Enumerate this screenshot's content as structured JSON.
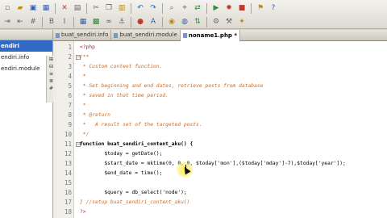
{
  "toolbar": {
    "row1": [
      {
        "name": "new-file-icon",
        "glyph": "▫",
        "color": "c-grey"
      },
      {
        "name": "open-folder-icon",
        "glyph": "▰",
        "color": "c-gold"
      },
      {
        "name": "save-icon",
        "glyph": "▣",
        "color": "c-blue"
      },
      {
        "name": "save-all-icon",
        "glyph": "▦",
        "color": "c-blue"
      },
      {
        "name": "sep"
      },
      {
        "name": "close-icon",
        "glyph": "✕",
        "color": "c-red"
      },
      {
        "name": "print-icon",
        "glyph": "▤",
        "color": "c-grey"
      },
      {
        "name": "sep"
      },
      {
        "name": "cut-icon",
        "glyph": "✂",
        "color": "c-grey"
      },
      {
        "name": "copy-icon",
        "glyph": "❐",
        "color": "c-grey"
      },
      {
        "name": "paste-icon",
        "glyph": "▥",
        "color": "c-gold"
      },
      {
        "name": "sep"
      },
      {
        "name": "undo-icon",
        "glyph": "↶",
        "color": "c-blue"
      },
      {
        "name": "redo-icon",
        "glyph": "↷",
        "color": "c-blue"
      },
      {
        "name": "sep"
      },
      {
        "name": "find-icon",
        "glyph": "⌕",
        "color": "c-grey"
      },
      {
        "name": "find-next-icon",
        "glyph": "⌖",
        "color": "c-grey"
      },
      {
        "name": "replace-icon",
        "glyph": "⇄",
        "color": "c-green"
      },
      {
        "name": "sep"
      },
      {
        "name": "run-icon",
        "glyph": "▶",
        "color": "c-green"
      },
      {
        "name": "debug-icon",
        "glyph": "✹",
        "color": "c-red"
      },
      {
        "name": "stop-icon",
        "glyph": "■",
        "color": "c-red"
      },
      {
        "name": "sep"
      },
      {
        "name": "bookmark-icon",
        "glyph": "⚑",
        "color": "c-gold"
      },
      {
        "name": "help-icon",
        "glyph": "?",
        "color": "c-blue"
      }
    ],
    "row2": [
      {
        "name": "indent-icon",
        "glyph": "⇥",
        "color": "c-grey"
      },
      {
        "name": "outdent-icon",
        "glyph": "⇤",
        "color": "c-grey"
      },
      {
        "name": "comment-icon",
        "glyph": "#",
        "color": "c-grey"
      },
      {
        "name": "sep"
      },
      {
        "name": "bold-icon",
        "glyph": "B",
        "color": "c-grey"
      },
      {
        "name": "italic-icon",
        "glyph": "I",
        "color": "c-grey"
      },
      {
        "name": "sep"
      },
      {
        "name": "table-icon",
        "glyph": "▦",
        "color": "c-blue"
      },
      {
        "name": "image-icon",
        "glyph": "▩",
        "color": "c-green"
      },
      {
        "name": "link-icon",
        "glyph": "∞",
        "color": "c-blue"
      },
      {
        "name": "anchor-icon",
        "glyph": "⚓",
        "color": "c-grey"
      },
      {
        "name": "sep"
      },
      {
        "name": "color-icon",
        "glyph": "●",
        "color": "c-red"
      },
      {
        "name": "font-icon",
        "glyph": "A",
        "color": "c-blue"
      },
      {
        "name": "sep"
      },
      {
        "name": "preview-icon",
        "glyph": "◉",
        "color": "c-gold"
      },
      {
        "name": "browser-icon",
        "glyph": "◍",
        "color": "c-blue"
      },
      {
        "name": "ftp-icon",
        "glyph": "⇅",
        "color": "c-green"
      },
      {
        "name": "sep"
      },
      {
        "name": "settings-icon",
        "glyph": "⚙",
        "color": "c-grey"
      },
      {
        "name": "tools-icon",
        "glyph": "⚒",
        "color": "c-grey"
      },
      {
        "name": "plugin-icon",
        "glyph": "✦",
        "color": "c-gold"
      }
    ]
  },
  "project_panel": {
    "items": [
      {
        "label": "endiri",
        "selected": true
      },
      {
        "label": "endiri.info",
        "selected": false
      },
      {
        "label": "endiri.module",
        "selected": false
      }
    ]
  },
  "side_toolbar": [
    "⊞",
    "⊟",
    "≡",
    "≣",
    "#"
  ],
  "tabs": [
    {
      "label": "buat_sendiri.info",
      "active": false
    },
    {
      "label": "buat_sendiri.module",
      "active": false
    },
    {
      "label": "noname1.php *",
      "active": true
    }
  ],
  "editor": {
    "lines": [
      {
        "num": "1",
        "text": "<?php",
        "kind": "php",
        "fold": ""
      },
      {
        "num": "2",
        "text": "/**",
        "kind": "comment",
        "fold": "−"
      },
      {
        "num": "3",
        "text": " * Custom content function.",
        "kind": "comment",
        "fold": ""
      },
      {
        "num": "4",
        "text": " *",
        "kind": "comment",
        "fold": ""
      },
      {
        "num": "5",
        "text": " * Set beginning and end dates, retrieve posts from database",
        "kind": "comment",
        "fold": ""
      },
      {
        "num": "6",
        "text": " * saved in that time period.",
        "kind": "comment",
        "fold": ""
      },
      {
        "num": "7",
        "text": " *",
        "kind": "comment",
        "fold": ""
      },
      {
        "num": "8",
        "text": " * @return",
        "kind": "comment",
        "fold": ""
      },
      {
        "num": "9",
        "text": " *   A result set of the targeted posts.",
        "kind": "comment",
        "fold": ""
      },
      {
        "num": "10",
        "text": " */",
        "kind": "comment",
        "fold": ""
      },
      {
        "num": "11",
        "text": "function buat_sendiri_content_aku() {",
        "kind": "keyword",
        "fold": "−"
      },
      {
        "num": "12",
        "text": "        $today = getDate();",
        "kind": "code",
        "fold": ""
      },
      {
        "num": "13",
        "text": "        $start_date = mktime(0, 0, 0, $today['mon'],($today['mday']-7),$today['year']);",
        "kind": "code",
        "fold": ""
      },
      {
        "num": "14",
        "text": "        $end_date = time();",
        "kind": "code",
        "fold": ""
      },
      {
        "num": "15",
        "text": "",
        "kind": "code",
        "fold": ""
      },
      {
        "num": "16",
        "text": "        $query = db_select('node');",
        "kind": "code",
        "fold": ""
      },
      {
        "num": "17",
        "text": "} //setup buat_sendiri_content_aku()",
        "kind": "comment",
        "fold": ""
      },
      {
        "num": "18",
        "text": "?>",
        "kind": "php",
        "fold": ""
      }
    ]
  }
}
